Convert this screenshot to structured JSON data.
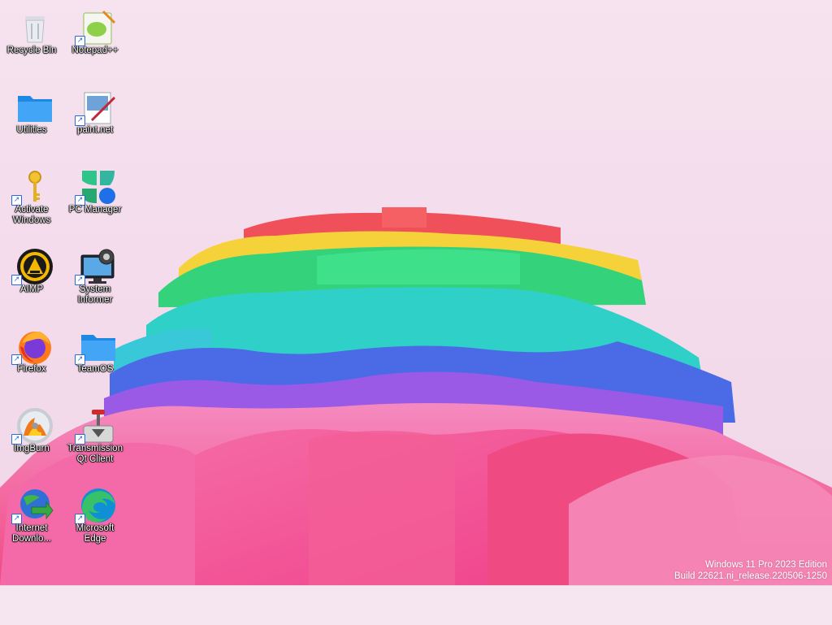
{
  "desktop": {
    "icons": [
      {
        "label": "Recycle Bin",
        "icon": "recycle-bin-icon",
        "shortcut": false
      },
      {
        "label": "Notepad++",
        "icon": "notepadpp-icon",
        "shortcut": true
      },
      {
        "label": "Utilities",
        "icon": "folder-icon",
        "shortcut": false
      },
      {
        "label": "paint.net",
        "icon": "paintnet-icon",
        "shortcut": true
      },
      {
        "label": "Activate Windows",
        "icon": "key-icon",
        "shortcut": true
      },
      {
        "label": "PC Manager",
        "icon": "pc-manager-icon",
        "shortcut": true
      },
      {
        "label": "AIMP",
        "icon": "aimp-icon",
        "shortcut": true
      },
      {
        "label": "System Informer",
        "icon": "system-informer-icon",
        "shortcut": true
      },
      {
        "label": "Firefox",
        "icon": "firefox-icon",
        "shortcut": true
      },
      {
        "label": "TeamOS",
        "icon": "folder-icon",
        "shortcut": true
      },
      {
        "label": "ImgBurn",
        "icon": "imgburn-icon",
        "shortcut": true
      },
      {
        "label": "Transmission Qt Client",
        "icon": "transmission-icon",
        "shortcut": true
      },
      {
        "label": "Internet Downlo...",
        "icon": "idm-icon",
        "shortcut": true
      },
      {
        "label": "Microsoft Edge",
        "icon": "edge-icon",
        "shortcut": true
      }
    ],
    "watermark_line1": "Windows 11 Pro 2023 Edition",
    "watermark_line2": "Build 22621.ni_release.220506-1250"
  },
  "colors": {
    "background": "#f4dcec",
    "ribbon_red": "#f0505a",
    "ribbon_yellow": "#f6d23a",
    "ribbon_green": "#34d27a",
    "ribbon_teal": "#2fd0c8",
    "ribbon_blue": "#4a6ae6",
    "ribbon_purple": "#9a5ae6",
    "ribbon_pink": "#f46aa8",
    "ribbon_rose": "#f04a82"
  }
}
